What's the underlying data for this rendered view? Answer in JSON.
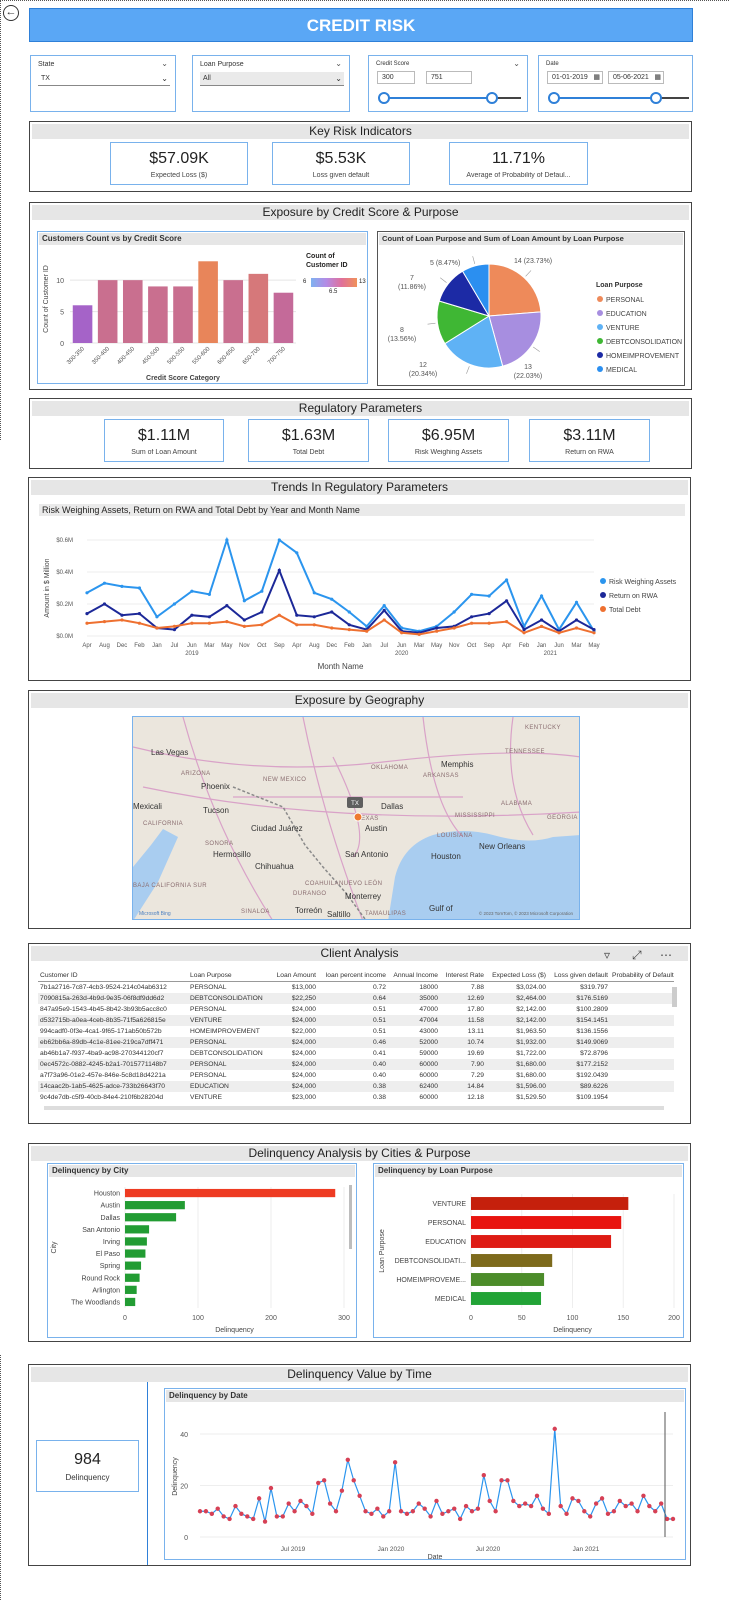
{
  "title": "CREDIT RISK",
  "filters": {
    "state": {
      "label": "State",
      "value": "TX"
    },
    "loan_purpose": {
      "label": "Loan Purpose",
      "value": "All"
    },
    "credit_score": {
      "label": "Credit Score",
      "min": "300",
      "max": "751"
    },
    "date": {
      "label": "Date",
      "start": "01-01-2019",
      "end": "05-06-2021"
    }
  },
  "key_risk": {
    "title": "Key Risk Indicators",
    "cards": [
      {
        "value": "$57.09K",
        "label": "Expected Loss ($)"
      },
      {
        "value": "$5.53K",
        "label": "Loss given default"
      },
      {
        "value": "11.71%",
        "label": "Average of Probability of Defaul..."
      }
    ]
  },
  "exposure": {
    "title": "Exposure by Credit Score & Purpose",
    "bar_title": "Customers Count vs by Credit Score",
    "bar_ylabel": "Count of Customer ID",
    "bar_xlabel": "Credit Score Category",
    "legend_title": "Count of Customer ID",
    "legend_min": "6",
    "legend_mid": "6.5",
    "legend_max": "13",
    "pie_title": "Count of Loan Purpose and Sum of Loan Amount by Loan Purpose",
    "pie_legend_title": "Loan Purpose"
  },
  "regulatory": {
    "title": "Regulatory Parameters",
    "cards": [
      {
        "value": "$1.11M",
        "label": "Sum of Loan Amount"
      },
      {
        "value": "$1.63M",
        "label": "Total Debt"
      },
      {
        "value": "$6.95M",
        "label": "Risk Weighing Assets"
      },
      {
        "value": "$3.11M",
        "label": "Return on RWA"
      }
    ]
  },
  "trends": {
    "title": "Trends In Regulatory Parameters",
    "subtitle": "Risk Weighing Assets, Return on RWA and Total Debt by Year and Month Name",
    "ylabel": "Amount in $ Million",
    "xlabel": "Month Name",
    "years": [
      "2019",
      "2020",
      "2021"
    ]
  },
  "geography": {
    "title": "Exposure by Geography",
    "labels": [
      "KENTUCKY",
      "Las Vegas",
      "TENNESSEE",
      "OKLAHOMA",
      "Memphis",
      "ARKANSAS",
      "ARIZONA",
      "NEW MEXICO",
      "Phoenix",
      "Dallas",
      "ALABAMA",
      "Mexicali",
      "Tucson",
      "MISSISSIPPI",
      "GEORGIA",
      "TEXAS",
      "Austin",
      "Ciudad Juárez",
      "LOUISIANA",
      "SONORA",
      "Hermosillo",
      "Houston",
      "New Orleans",
      "San Antonio",
      "Chihuahua",
      "COAHUILA",
      "NUEVO LEÓN",
      "Monterrey",
      "DURANGO",
      "Torreón",
      "Saltillo",
      "TAMAULIPAS",
      "SINALOA",
      "Gulf of",
      "BAJA CALIFORNIA SUR",
      "CALIFORNIA"
    ],
    "marker": "TX",
    "attribution": "Microsoft Bing",
    "copyright": "© 2023 TomTom, © 2023 Microsoft Corporation"
  },
  "client": {
    "title": "Client Analysis",
    "columns": [
      "Customer ID",
      "Loan Purpose",
      "Loan Amount",
      "loan percent income",
      "Annual Income",
      "Interest Rate",
      "Expected Loss ($)",
      "Loss given default",
      "Probability of Default"
    ],
    "rows": [
      [
        "7b1a2716-7c87-4cb3-9524-214c04ab6312",
        "PERSONAL",
        "$13,000",
        "0.72",
        "18000",
        "7.88",
        "$3,024.00",
        "$319.797"
      ],
      [
        "7090815a-263d-4b9d-9e35-06f8df9dd6d2",
        "DEBTCONSOLIDATION",
        "$22,250",
        "0.64",
        "35000",
        "12.69",
        "$2,464.00",
        "$176.5169"
      ],
      [
        "847a95e9-1543-4b45-8b42-3b93b5acc8c0",
        "PERSONAL",
        "$24,000",
        "0.51",
        "47000",
        "17.80",
        "$2,142.00",
        "$100.2809"
      ],
      [
        "d532715b-a0ea-4ceb-8b35-71f5a626815e",
        "VENTURE",
        "$24,000",
        "0.51",
        "47004",
        "11.58",
        "$2,142.00",
        "$154.1451"
      ],
      [
        "994cadf0-0f3e-4ca1-9f65-171ab50b572b",
        "HOMEIMPROVEMENT",
        "$22,000",
        "0.51",
        "43000",
        "13.11",
        "$1,963.50",
        "$136.1556"
      ],
      [
        "eb62bb6a-89db-4c1e-81ee-219ca7dff471",
        "PERSONAL",
        "$24,000",
        "0.46",
        "52000",
        "10.74",
        "$1,932.00",
        "$149.9069"
      ],
      [
        "ab46b1a7-f937-4ba9-ac98-270344120cf7",
        "DEBTCONSOLIDATION",
        "$24,000",
        "0.41",
        "59000",
        "19.69",
        "$1,722.00",
        "$72.8796"
      ],
      [
        "0ec4572c-0882-4245-b2a1-7015771148b7",
        "PERSONAL",
        "$24,000",
        "0.40",
        "60000",
        "7.90",
        "$1,680.00",
        "$177.2152"
      ],
      [
        "a7f73a96-01e2-457e-846e-5c8d18d4221a",
        "PERSONAL",
        "$24,000",
        "0.40",
        "60000",
        "7.29",
        "$1,680.00",
        "$192.0439"
      ],
      [
        "14caac2b-1ab5-4625-adce-733b26643f70",
        "EDUCATION",
        "$24,000",
        "0.38",
        "62400",
        "14.84",
        "$1,596.00",
        "$89.6226"
      ],
      [
        "9c4de7db-c5f9-40cb-84e4-210f6b28204d",
        "VENTURE",
        "$23,000",
        "0.38",
        "60000",
        "12.18",
        "$1,529.50",
        "$109.1954"
      ]
    ]
  },
  "delinquency": {
    "title": "Delinquency Analysis by Cities & Purpose",
    "city_title": "Delinquency by City",
    "city_xlabel": "Delinquency",
    "city_ylabel": "City",
    "purpose_title": "Delinquency by Loan Purpose",
    "purpose_xlabel": "Delinquency",
    "purpose_ylabel": "Loan Purpose"
  },
  "delinq_time": {
    "title": "Delinquency Value by Time",
    "card_value": "984",
    "card_label": "Delinquency",
    "chart_title": "Delinquency by Date",
    "ylabel": "Delinquency",
    "xlabel": "Date"
  },
  "chart_data": [
    {
      "type": "bar",
      "title": "Customers Count vs by Credit Score",
      "xlabel": "Credit Score Category",
      "ylabel": "Count of Customer ID",
      "categories": [
        "300-350",
        "350-400",
        "400-450",
        "450-500",
        "500-550",
        "550-600",
        "600-650",
        "650-700",
        "700-750"
      ],
      "values": [
        6,
        10,
        10,
        9,
        9,
        13,
        10,
        11,
        8
      ],
      "ylim": [
        0,
        14
      ],
      "yticks": [
        "0",
        "5",
        "10"
      ],
      "colors": [
        "#a563c8",
        "#c96f8f",
        "#c96f8f",
        "#c96f8f",
        "#c96f8f",
        "#e8855a",
        "#c96f8f",
        "#d6787a",
        "#c46a99"
      ]
    },
    {
      "type": "pie",
      "title": "Count of Loan Purpose and Sum of Loan Amount by Loan Purpose",
      "categories": [
        "PERSONAL",
        "EDUCATION",
        "VENTURE",
        "DEBTCONSOLIDATION",
        "HOMEIMPROVEMENT",
        "MEDICAL"
      ],
      "values": [
        14,
        13,
        12,
        8,
        7,
        5
      ],
      "labels": [
        "14 (23.73%)",
        "13 (22.03%)",
        "12 (20.34%)",
        "8 (13.56%)",
        "7 (11.86%)",
        "5 (8.47%)"
      ],
      "colors": [
        "#ee8a5a",
        "#a78ee0",
        "#5fb2f5",
        "#3fb734",
        "#1c2aa5",
        "#2b8ff0"
      ]
    },
    {
      "type": "line",
      "title": "Risk Weighing Assets, Return on RWA and Total Debt by Year and Month Name",
      "xlabel": "Month Name",
      "ylabel": "Amount in $ Million",
      "x": [
        "Apr",
        "Aug",
        "Dec",
        "Feb",
        "Jan",
        "Jul",
        "Jun",
        "Mar",
        "May",
        "Nov",
        "Oct",
        "Sep",
        "Apr",
        "Aug",
        "Dec",
        "Feb",
        "Jan",
        "Jul",
        "Jun",
        "Mar",
        "May",
        "Nov",
        "Oct",
        "Sep",
        "Apr",
        "Feb",
        "Jan",
        "Jun",
        "Mar",
        "May"
      ],
      "yticks": [
        "$0.0M",
        "$0.2M",
        "$0.4M",
        "$0.6M"
      ],
      "ylim": [
        0,
        0.6
      ],
      "series": [
        {
          "name": "Risk Weighing Assets",
          "color": "#2b95ee",
          "values": [
            0.27,
            0.33,
            0.31,
            0.3,
            0.12,
            0.2,
            0.28,
            0.26,
            0.6,
            0.22,
            0.28,
            0.6,
            0.52,
            0.27,
            0.23,
            0.15,
            0.06,
            0.19,
            0.05,
            0.03,
            0.06,
            0.15,
            0.26,
            0.25,
            0.35,
            0.06,
            0.25,
            0.04,
            0.21,
            0.03
          ]
        },
        {
          "name": "Return on RWA",
          "color": "#1c2898",
          "values": [
            0.14,
            0.2,
            0.13,
            0.14,
            0.05,
            0.04,
            0.13,
            0.12,
            0.19,
            0.1,
            0.15,
            0.41,
            0.13,
            0.12,
            0.15,
            0.07,
            0.04,
            0.16,
            0.03,
            0.02,
            0.05,
            0.06,
            0.12,
            0.14,
            0.22,
            0.04,
            0.1,
            0.03,
            0.1,
            0.04
          ]
        },
        {
          "name": "Total Debt",
          "color": "#ee7030",
          "values": [
            0.08,
            0.09,
            0.1,
            0.08,
            0.05,
            0.06,
            0.08,
            0.08,
            0.09,
            0.06,
            0.07,
            0.13,
            0.07,
            0.07,
            0.05,
            0.04,
            0.03,
            0.1,
            0.02,
            0.01,
            0.03,
            0.05,
            0.08,
            0.08,
            0.09,
            0.02,
            0.06,
            0.02,
            0.05,
            0.02
          ]
        }
      ]
    },
    {
      "type": "bar",
      "orientation": "horizontal",
      "title": "Delinquency by City",
      "xlabel": "Delinquency",
      "ylabel": "City",
      "categories": [
        "Houston",
        "Austin",
        "Dallas",
        "San Antonio",
        "Irving",
        "El Paso",
        "Spring",
        "Round Rock",
        "Arlington",
        "The Woodlands"
      ],
      "values": [
        288,
        82,
        70,
        33,
        30,
        28,
        22,
        20,
        16,
        14
      ],
      "colors": [
        "#ee3b22",
        "#229c33",
        "#229c33",
        "#229c33",
        "#229c33",
        "#229c33",
        "#229c33",
        "#229c33",
        "#229c33",
        "#229c33"
      ],
      "xlim": [
        0,
        300
      ],
      "xticks": [
        "0",
        "100",
        "200",
        "300"
      ]
    },
    {
      "type": "bar",
      "orientation": "horizontal",
      "title": "Delinquency by Loan Purpose",
      "xlabel": "Delinquency",
      "ylabel": "Loan Purpose",
      "categories": [
        "VENTURE",
        "PERSONAL",
        "EDUCATION",
        "DEBTCONSOLIDATI...",
        "HOMEIMPROVEME...",
        "MEDICAL"
      ],
      "values": [
        155,
        148,
        138,
        80,
        72,
        69
      ],
      "colors": [
        "#c5200c",
        "#e8140f",
        "#de1b14",
        "#7d6a1c",
        "#4c8c2a",
        "#22a336"
      ],
      "xlim": [
        0,
        200
      ],
      "xticks": [
        "0",
        "50",
        "100",
        "150",
        "200"
      ]
    },
    {
      "type": "line",
      "title": "Delinquency by Date",
      "xlabel": "Date",
      "ylabel": "Delinquency",
      "xticks": [
        "Jul 2019",
        "Jan 2020",
        "Jul 2020",
        "Jan 2021"
      ],
      "yticks": [
        "0",
        "20",
        "40"
      ],
      "ylim": [
        0,
        47
      ],
      "values": [
        10,
        10,
        9,
        11,
        8,
        7,
        12,
        9,
        8,
        7,
        15,
        6,
        19,
        8,
        8,
        13,
        10,
        14,
        12,
        9,
        21,
        22,
        13,
        10,
        18,
        30,
        22,
        16,
        10,
        9,
        11,
        8,
        10,
        29,
        10,
        9,
        10,
        13,
        11,
        8,
        14,
        9,
        10,
        11,
        7,
        12,
        10,
        11,
        24,
        14,
        10,
        22,
        22,
        14,
        12,
        13,
        12,
        16,
        11,
        9,
        42,
        12,
        9,
        15,
        14,
        10,
        8,
        13,
        15,
        9,
        10,
        14,
        12,
        13,
        10,
        16,
        12,
        10,
        13,
        7,
        7
      ]
    }
  ]
}
